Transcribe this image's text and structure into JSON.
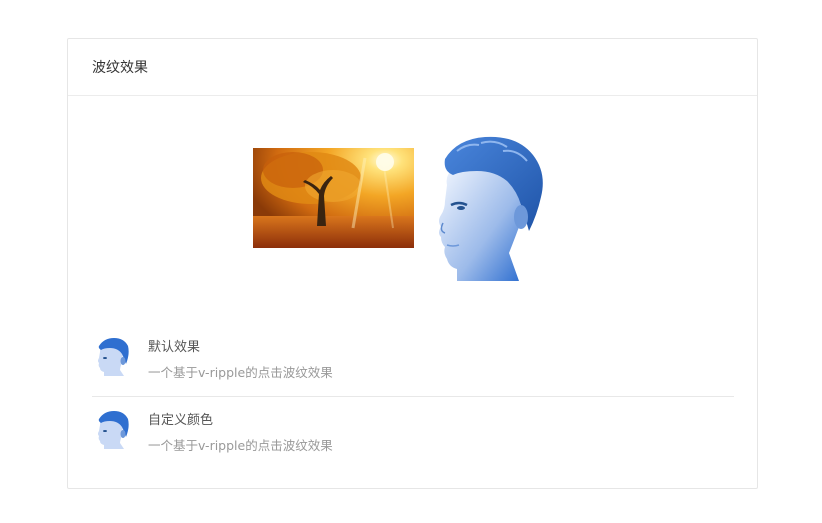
{
  "card": {
    "title": "波纹效果"
  },
  "images": {
    "autumn": "autumn-forest-photo",
    "portrait": "blue-portrait-head"
  },
  "list": {
    "items": [
      {
        "title": "默认效果",
        "subtitle": "一个基于v-ripple的点击波纹效果",
        "avatar": "blue-portrait-avatar"
      },
      {
        "title": "自定义颜色",
        "subtitle": "一个基于v-ripple的点击波纹效果",
        "avatar": "blue-portrait-avatar"
      }
    ]
  },
  "colors": {
    "border": "#e6e6e6",
    "title_text": "#333333",
    "subtitle_text": "#999999",
    "portrait_blue": "#2f6fd0"
  }
}
